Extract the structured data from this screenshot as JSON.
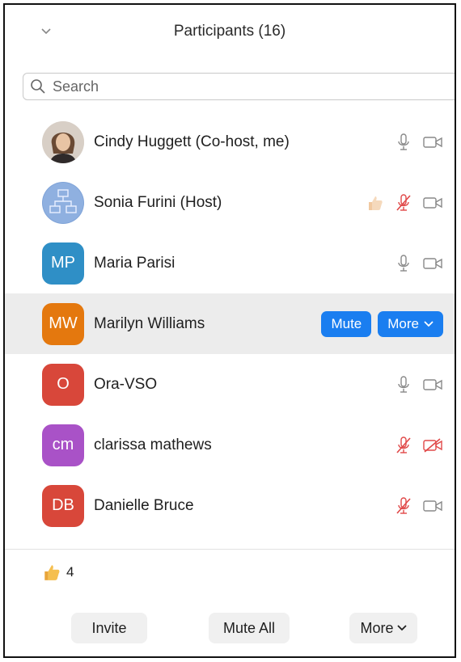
{
  "header": {
    "title": "Participants (16)"
  },
  "search": {
    "placeholder": "Search"
  },
  "participants": [
    {
      "name": "Cindy Huggett (Co-host, me)",
      "initials": "",
      "avatar_type": "photo",
      "avatar_color": "#8a6a55",
      "mic": "on",
      "video": "on",
      "reaction": ""
    },
    {
      "name": "Sonia Furini (Host)",
      "initials": "",
      "avatar_type": "globe",
      "avatar_color": "#6a8fcc",
      "mic": "muted",
      "video": "on",
      "reaction": "thumbs-up"
    },
    {
      "name": "Maria Parisi",
      "initials": "MP",
      "avatar_type": "initials",
      "avatar_color": "#2f8fc6",
      "mic": "on",
      "video": "on",
      "reaction": ""
    },
    {
      "name": "Marilyn Williams",
      "initials": "MW",
      "avatar_type": "initials",
      "avatar_color": "#e4780e",
      "mic": "on",
      "video": "on",
      "reaction": ""
    },
    {
      "name": "Ora-VSO",
      "initials": "O",
      "avatar_type": "initials",
      "avatar_color": "#d8473a",
      "mic": "on",
      "video": "on",
      "reaction": ""
    },
    {
      "name": "clarissa mathews",
      "initials": "cm",
      "avatar_type": "initials",
      "avatar_color": "#a952c7",
      "mic": "muted",
      "video": "off",
      "reaction": ""
    },
    {
      "name": "Danielle Bruce",
      "initials": "DB",
      "avatar_type": "initials",
      "avatar_color": "#d8473a",
      "mic": "muted",
      "video": "on",
      "reaction": ""
    }
  ],
  "row_actions": {
    "mute_label": "Mute",
    "more_label": "More"
  },
  "reactions_summary": {
    "icon": "thumbs-up",
    "count": "4"
  },
  "footer": {
    "invite_label": "Invite",
    "mute_all_label": "Mute All",
    "more_label": "More"
  },
  "colors": {
    "accent": "#1a7ef0",
    "muted_red": "#e04848",
    "hover_row": "#ececec"
  }
}
